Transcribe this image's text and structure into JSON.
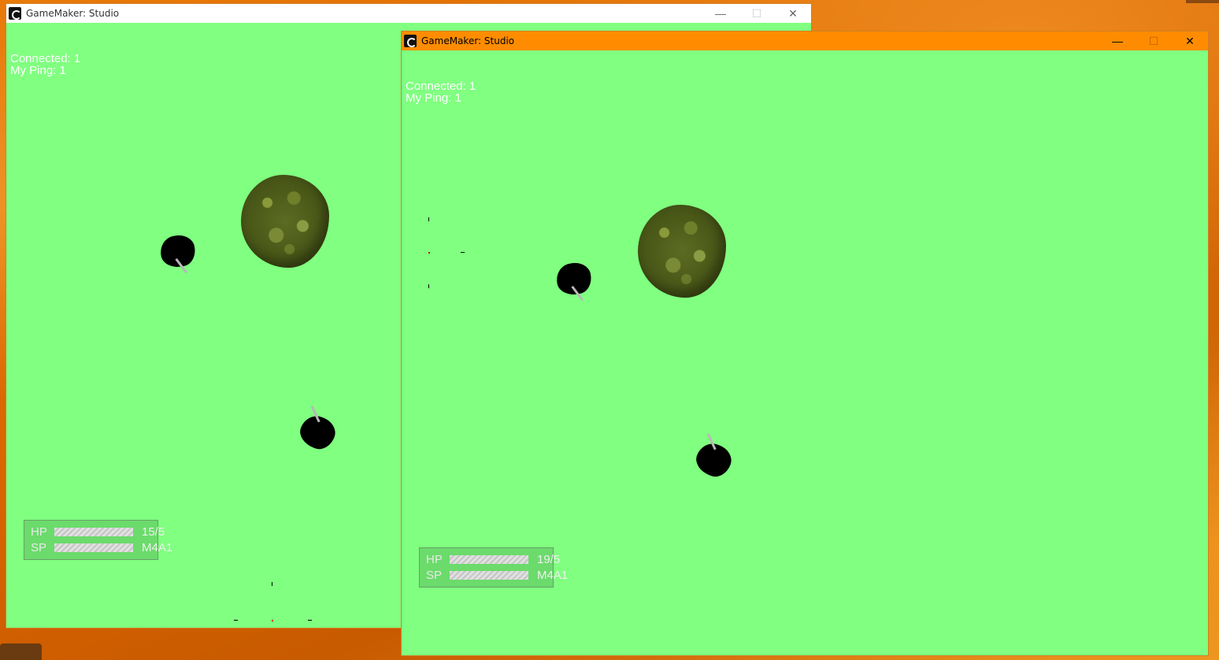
{
  "windows": [
    {
      "title": "GameMaker: Studio",
      "controls": {
        "minimize": "—",
        "maximize": "☐",
        "close": "✕"
      },
      "hud": {
        "connected": "Connected: 1",
        "ping": "My Ping: 1"
      },
      "stats": {
        "hp_label": "HP",
        "hp_value": "15/5",
        "sp_label": "SP",
        "weapon": "M4A1"
      }
    },
    {
      "title": "GameMaker: Studio",
      "controls": {
        "minimize": "—",
        "maximize": "☐",
        "close": "✕"
      },
      "hud": {
        "connected": "Connected: 1",
        "ping": "My Ping: 1"
      },
      "stats": {
        "hp_label": "HP",
        "hp_value": "19/5",
        "sp_label": "SP",
        "weapon": "M4A1"
      }
    }
  ],
  "colors": {
    "game_background": "#80ff80",
    "active_titlebar": "#ff8c00",
    "inactive_titlebar": "#ffffff"
  },
  "icons": {
    "app": "gamemaker-logo-icon",
    "minimize": "minimize-icon",
    "maximize": "maximize-icon",
    "close": "close-icon"
  }
}
